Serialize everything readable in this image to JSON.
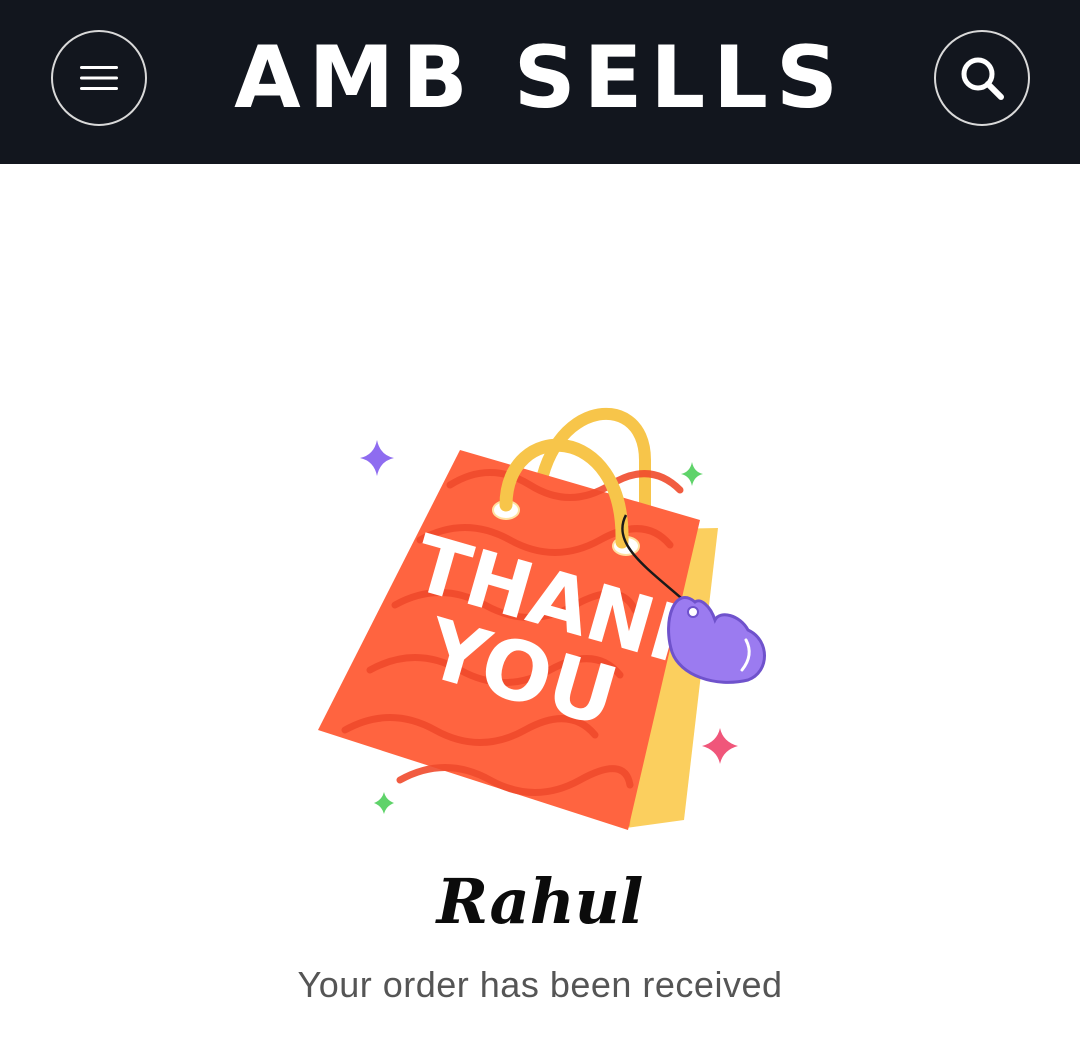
{
  "header": {
    "brand": "AMB SELLS",
    "menu_icon": "hamburger-menu-icon",
    "search_icon": "search-icon",
    "background_color": "#12161e"
  },
  "confirmation": {
    "illustration_text_line1": "THANK",
    "illustration_text_line2": "YOU",
    "customer_name": "Rahul",
    "message": "Your order has been received"
  },
  "colors": {
    "bag": "#ff6440",
    "handle": "#f7c54a",
    "heart": "#9b7bf0",
    "sparkle_pink": "#f0567a",
    "sparkle_green": "#5fd36a",
    "sparkle_purple": "#8e6cf0"
  }
}
